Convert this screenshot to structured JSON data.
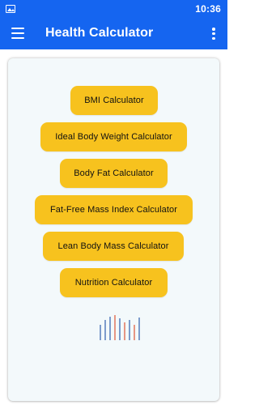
{
  "status_bar": {
    "time": "10:36",
    "left_icon": "gallery-icon"
  },
  "app_bar": {
    "title": "Health Calculator",
    "nav_icon": "menu-icon",
    "action_icon": "overflow-icon"
  },
  "calculators": [
    {
      "label": "BMI Calculator"
    },
    {
      "label": "Ideal Body Weight Calculator"
    },
    {
      "label": "Body Fat Calculator"
    },
    {
      "label": "Fat-Free Mass Index Calculator"
    },
    {
      "label": "Lean Body Mass Calculator"
    },
    {
      "label": "Nutrition Calculator"
    }
  ],
  "colors": {
    "primary": "#1565f0",
    "button": "#f7c21e",
    "card_background": "#f3f9fb",
    "logo_blue": "#4a73b8",
    "logo_red": "#e06b52"
  },
  "footer_graphic": {
    "icon": "bar-lines-logo-icon"
  }
}
